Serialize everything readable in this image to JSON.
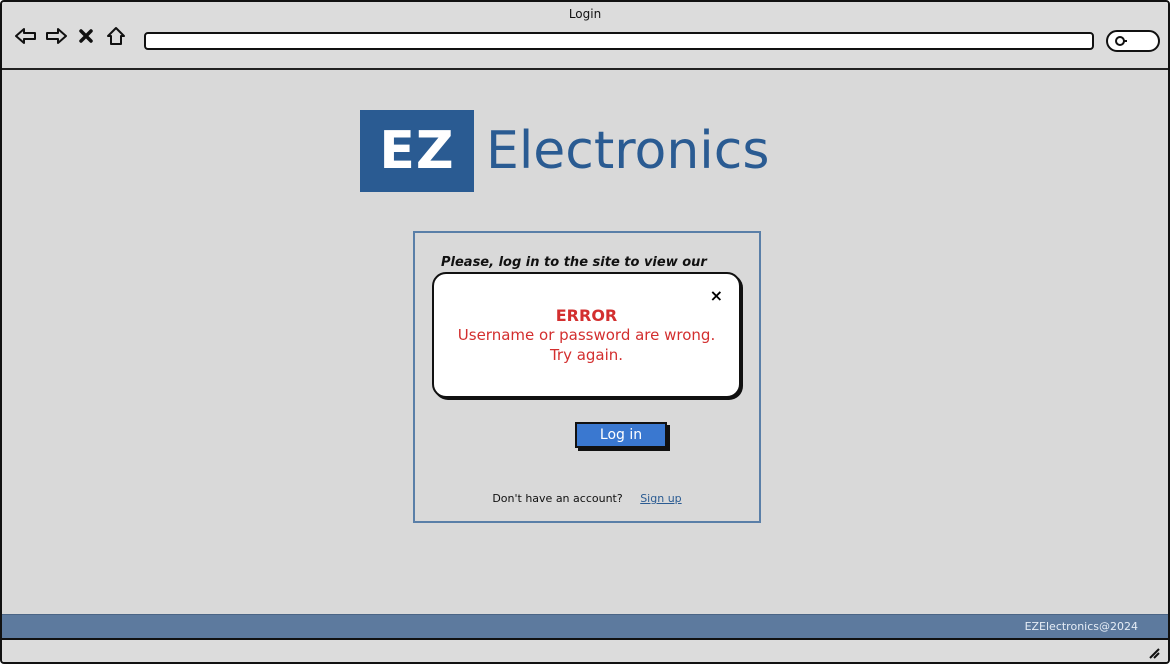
{
  "window": {
    "title": "Login",
    "address": ""
  },
  "nav": {
    "icons": [
      "back-arrow-icon",
      "forward-arrow-icon",
      "close-icon",
      "home-icon"
    ]
  },
  "search": {
    "icon": "search-icon"
  },
  "logo": {
    "box_text": "EZ",
    "text": "Electronics",
    "brand_color": "#2a5b92"
  },
  "panel": {
    "prompt": "Please, log in to the site to view our",
    "login_label": "Log in",
    "signup_prompt": "Don't have an account?",
    "signup_link": "Sign up"
  },
  "error_modal": {
    "title": "ERROR",
    "line1": "Username or password are wrong.",
    "line2": "Try again.",
    "close_label": "×",
    "accent_color": "#d32f2f"
  },
  "footer": {
    "text": "EZElectronics@2024"
  },
  "colors": {
    "login_button": "#3a78d0",
    "footer": "#5d7a9e",
    "background": "#d9d9d9"
  }
}
